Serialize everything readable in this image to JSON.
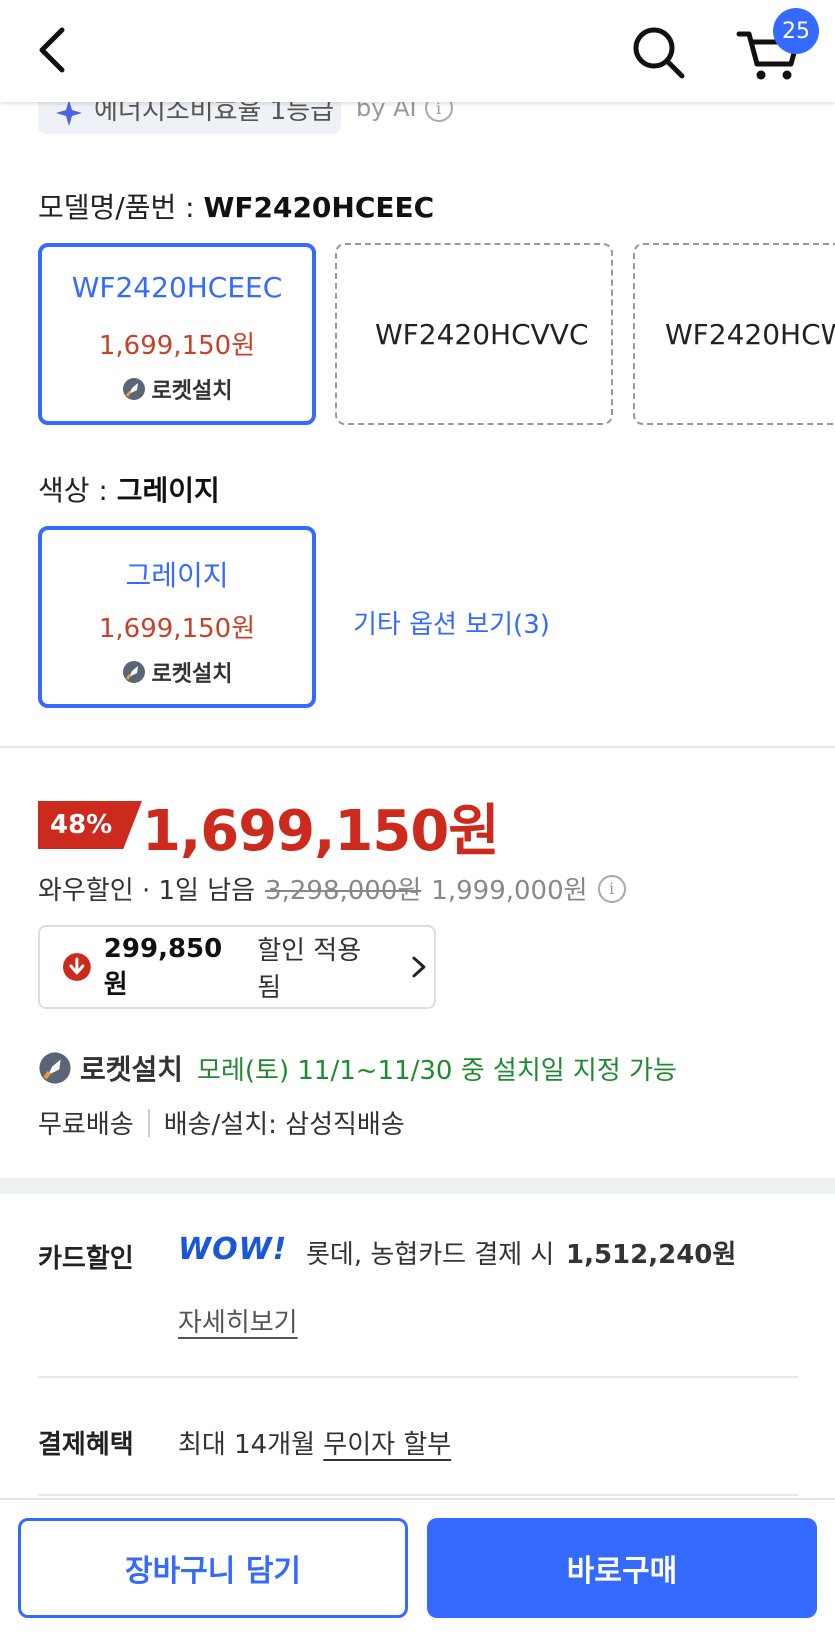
{
  "header": {
    "cart_count": "25"
  },
  "ai_tag": {
    "text": "에너지소비효율 1등급",
    "by": "by AI",
    "info": "i"
  },
  "model_option": {
    "label": "모델명/품번",
    "selected_value": "WF2420HCEEC",
    "cards": [
      {
        "name": "WF2420HCEEC",
        "price": "1,699,150원",
        "badge": "로켓설치"
      },
      {
        "name": "WF2420HCVVC"
      },
      {
        "name": "WF2420HCW"
      }
    ]
  },
  "color_option": {
    "label": "색상",
    "selected_value": "그레이지",
    "card": {
      "name": "그레이지",
      "price": "1,699,150원",
      "badge": "로켓설치"
    },
    "more_link": "기타 옵션 보기(3)"
  },
  "price": {
    "discount": "48%",
    "final": "1,699,150원",
    "wow_label": "와우할인 · 1일 남음",
    "original_strike": "3,298,000원",
    "original_price": "1,999,000원",
    "info": "i"
  },
  "coupon": {
    "amount": "299,850원",
    "label": "할인 적용됨"
  },
  "delivery": {
    "rocket_label": "로켓설치",
    "date_text": "모레(토) 11/1~11/30 중 설치일 지정 가능",
    "free_shipping": "무료배송",
    "shipper": "배송/설치: 삼성직배송"
  },
  "card_discount": {
    "label": "카드할인",
    "logo": "WOW!",
    "text": "롯데, 농협카드 결제 시",
    "amount": "1,512,240원",
    "link": "자세히보기"
  },
  "payment_benefit": {
    "label": "결제혜택",
    "prefix": "최대 14개월",
    "link": "무이자 할부"
  },
  "bottom": {
    "cart_button": "장바구니 담기",
    "buy_button": "바로구매"
  },
  "colors": {
    "accent": "#346aff",
    "price_red": "#cc2a1c",
    "delivery_green": "#1e8b2f"
  }
}
